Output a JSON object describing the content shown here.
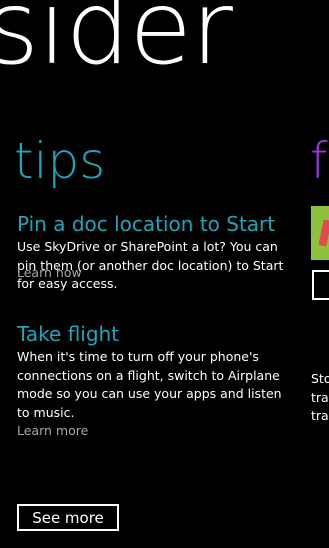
{
  "app": {
    "title": "sider"
  },
  "tips": {
    "section_title": "tips",
    "items": [
      {
        "heading": "Pin a doc location to Start",
        "body": "Use SkyDrive or SharePoint a lot? You can pin them (or another doc location) to Start for easy access.",
        "link": "Learn how"
      },
      {
        "heading": "Take flight",
        "body": "When it's time to turn off your phone's connections on a flight, switch to Airplane mode so you can use your apps and listen to music.",
        "link": "Learn more"
      }
    ],
    "see_more_label": "See more"
  },
  "next_panel": {
    "title_peek": "f",
    "text_lines": [
      "Sto",
      "tra",
      "tra"
    ]
  },
  "colors": {
    "accent": "#1fa5b7",
    "next_accent": "#9b30e0",
    "background": "#000000",
    "link": "#a6a6a6"
  }
}
